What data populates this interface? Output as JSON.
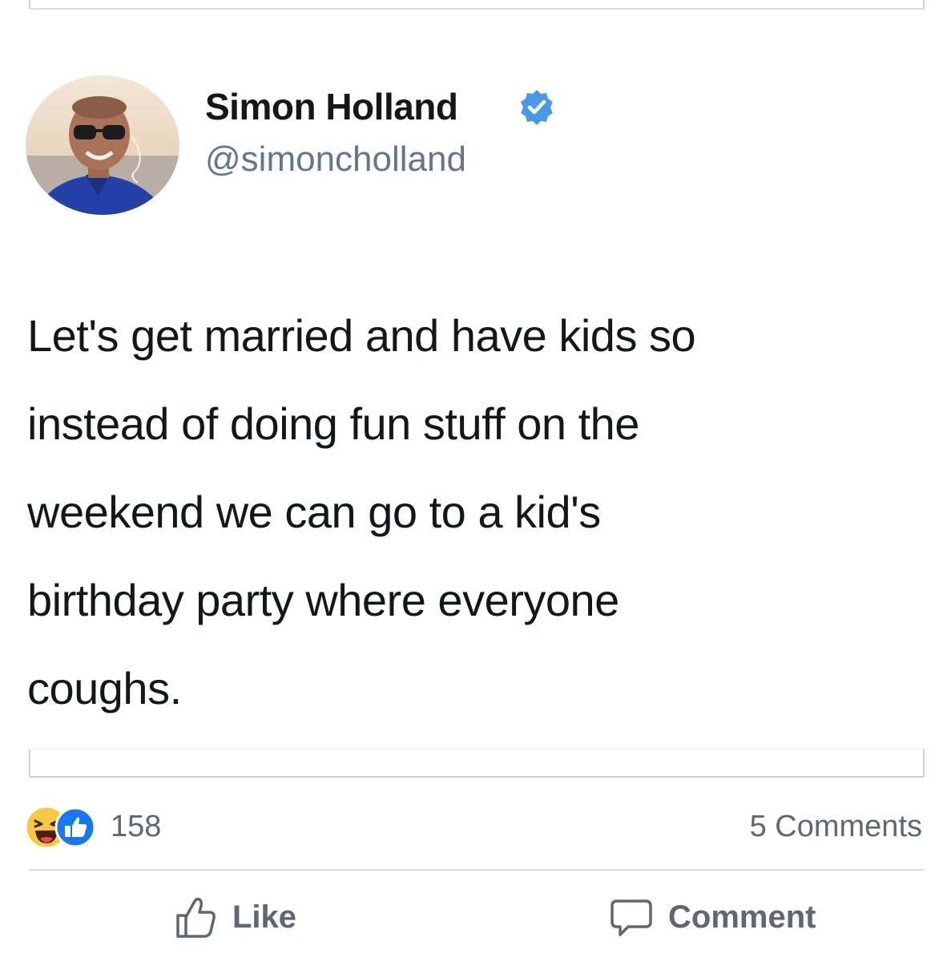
{
  "tweet": {
    "display_name": "Simon Holland",
    "handle": "@simoncholland",
    "text": "Let's get married and have kids so\ninstead of doing fun stuff on the\nweekend we can go to a kid's\nbirthday party where everyone\ncoughs.",
    "verified": true
  },
  "post": {
    "reactions": [
      "haha",
      "like"
    ],
    "reaction_count": "158",
    "comments_label": "5 Comments"
  },
  "actions": {
    "like_label": "Like",
    "comment_label": "Comment"
  },
  "colors": {
    "verified_blue": "#4a99e9",
    "like_blue": "#1877f2",
    "haha_yellow": "#f7c842",
    "meta_gray": "#606770"
  }
}
